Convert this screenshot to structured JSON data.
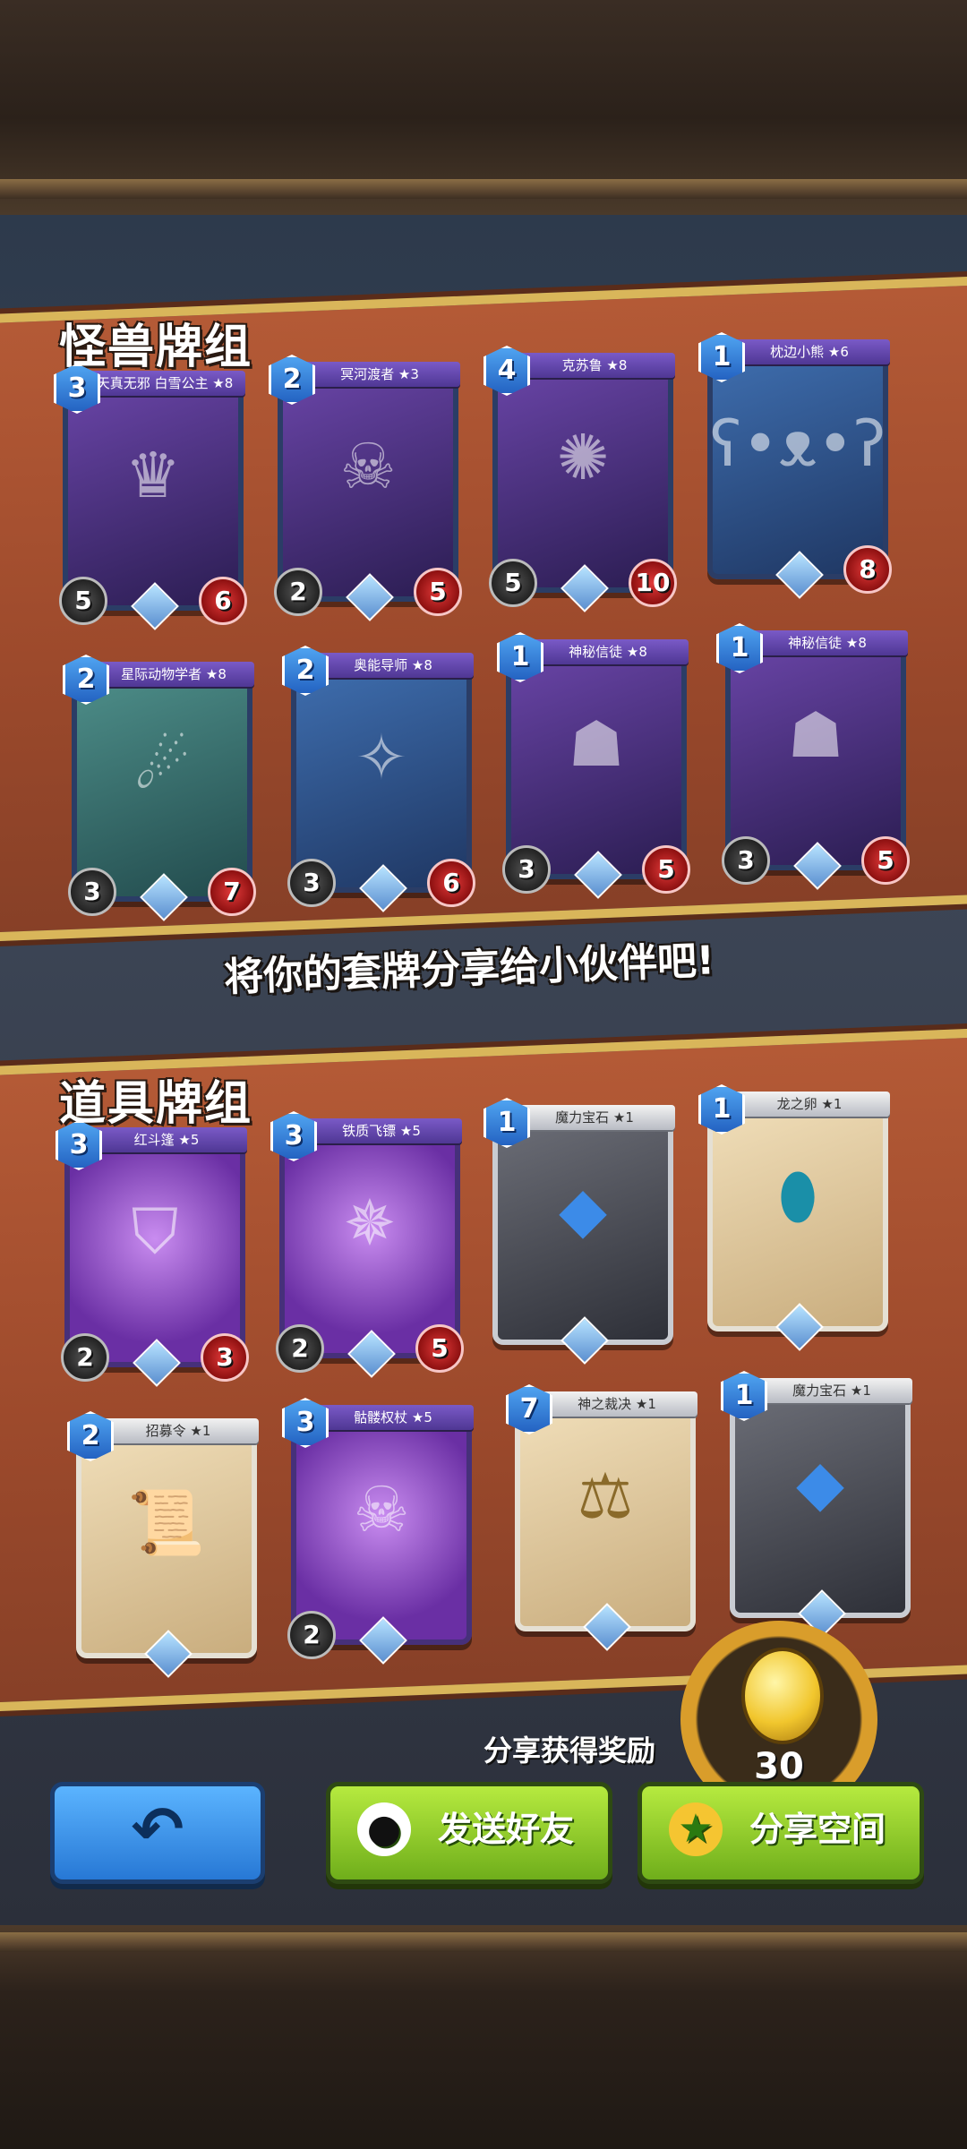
{
  "sections": {
    "monster_title": "怪兽牌组",
    "item_title": "道具牌组"
  },
  "share_prompt": "将你的套牌分享给小伙伴吧!",
  "monster_cards": [
    {
      "name": "天真无邪 白雪公主 ★8",
      "cost": "3",
      "atk": "5",
      "hp": "6"
    },
    {
      "name": "冥河渡者 ★3",
      "cost": "2",
      "atk": "2",
      "hp": "5"
    },
    {
      "name": "克苏鲁 ★8",
      "cost": "4",
      "atk": "5",
      "hp": "10"
    },
    {
      "name": "枕边小熊 ★6",
      "cost": "1",
      "atk": "",
      "hp": "8"
    },
    {
      "name": "星际动物学者 ★8",
      "cost": "2",
      "atk": "3",
      "hp": "7"
    },
    {
      "name": "奥能导师 ★8",
      "cost": "2",
      "atk": "3",
      "hp": "6"
    },
    {
      "name": "神秘信徒 ★8",
      "cost": "1",
      "atk": "3",
      "hp": "5"
    },
    {
      "name": "神秘信徒 ★8",
      "cost": "1",
      "atk": "3",
      "hp": "5"
    }
  ],
  "item_cards": [
    {
      "name": "红斗篷 ★5",
      "cost": "3",
      "atk": "2",
      "hp": "3"
    },
    {
      "name": "铁质飞镖 ★5",
      "cost": "3",
      "atk": "2",
      "hp": "5"
    },
    {
      "name": "魔力宝石 ★1",
      "cost": "1",
      "atk": "",
      "hp": ""
    },
    {
      "name": "龙之卵 ★1",
      "cost": "1",
      "atk": "",
      "hp": ""
    },
    {
      "name": "招募令 ★1",
      "cost": "2",
      "atk": "",
      "hp": ""
    },
    {
      "name": "骷髅权杖 ★5",
      "cost": "3",
      "atk": "2",
      "hp": ""
    },
    {
      "name": "神之裁决 ★1",
      "cost": "7",
      "atk": "",
      "hp": ""
    },
    {
      "name": "魔力宝石 ★1",
      "cost": "1",
      "atk": "",
      "hp": ""
    }
  ],
  "reward": {
    "label": "分享获得奖励",
    "coin_amount": "30"
  },
  "buttons": {
    "back_icon": "↶",
    "send_friend": "发送好友",
    "share_space": "分享空间"
  },
  "colors": {
    "banner": "#a64e2e",
    "green_button": "#8cc928",
    "blue_button": "#3b8fe6"
  }
}
